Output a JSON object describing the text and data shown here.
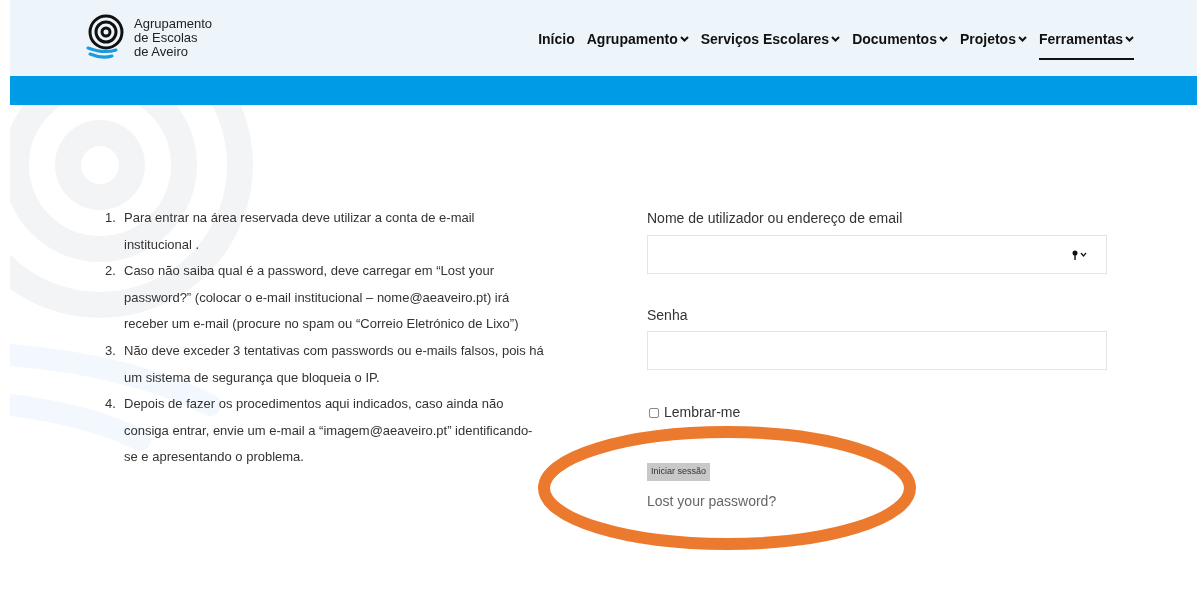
{
  "logo": {
    "lines": [
      "Agrupamento",
      "de Escolas",
      "de Aveiro"
    ]
  },
  "nav": [
    {
      "label": "Início",
      "dropdown": false,
      "selected": false
    },
    {
      "label": "Agrupamento",
      "dropdown": true,
      "selected": false
    },
    {
      "label": "Serviços Escolares",
      "dropdown": true,
      "selected": false
    },
    {
      "label": "Documentos",
      "dropdown": true,
      "selected": false
    },
    {
      "label": "Projetos",
      "dropdown": true,
      "selected": false
    },
    {
      "label": "Ferramentas",
      "dropdown": true,
      "selected": true
    }
  ],
  "instructions": [
    {
      "number": "1.",
      "text": "Para entrar na área reservada deve utilizar a conta de e-mail institucional ."
    },
    {
      "number": "2.",
      "text": "Caso não saiba qual é a password, deve carregar em “Lost your password?” (colocar o e-mail institucional – nome@aeaveiro.pt) irá receber um e-mail (procure no spam ou “Correio Eletrónico de Lixo”)"
    },
    {
      "number": "3.",
      "text": "Não deve exceder 3 tentativas com passwords ou e-mails falsos, pois há um sistema de segurança que bloqueia o IP."
    },
    {
      "number": "4.",
      "text": "Depois de fazer os procedimentos aqui indicados, caso ainda não consiga entrar, envie um e-mail a “imagem@aeaveiro.pt” identificando-se e apresentando o problema."
    }
  ],
  "login": {
    "username_label": "Nome de utilizador ou endereço de email",
    "password_label": "Senha",
    "remember": {
      "label": "Lembrar-me",
      "checked": false
    },
    "submit": "Iniciar sessão",
    "lost_password": "Lost your password?"
  }
}
